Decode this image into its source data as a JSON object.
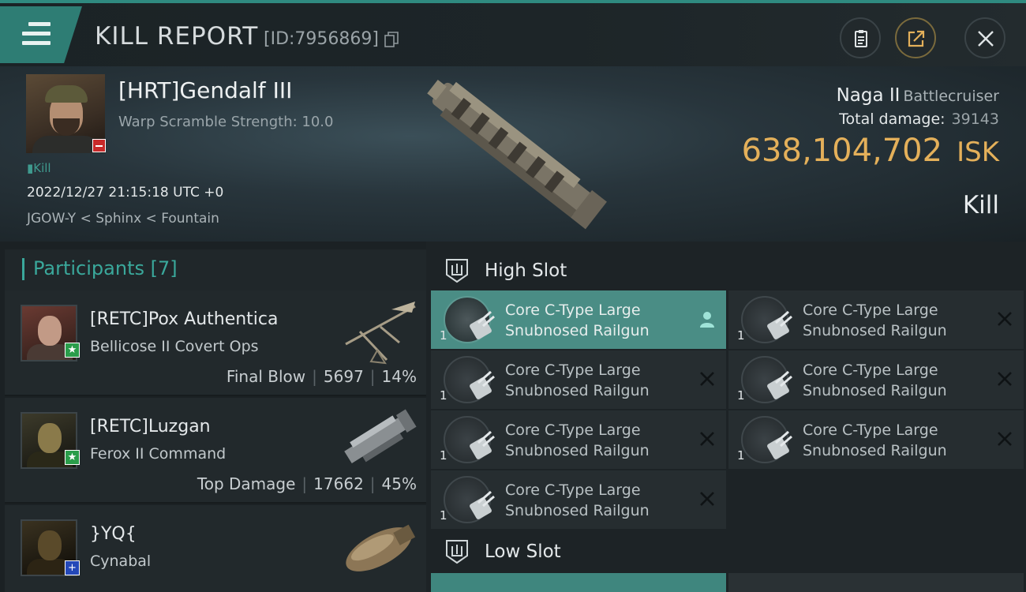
{
  "header": {
    "title": "KILL REPORT",
    "report_id": "[ID:7956869]",
    "icons": [
      "menu-icon",
      "copy-icon",
      "clipboard-icon",
      "share-icon",
      "close-icon"
    ]
  },
  "victim": {
    "name": "[HRT]Gendalf III",
    "warp_scramble": "Warp Scramble Strength: 10.0",
    "kill_tag": "Kill",
    "timestamp": "2022/12/27 21:15:18 UTC +0",
    "location": "JGOW-Y < Sphinx < Fountain",
    "ship_name": "Naga II",
    "ship_class": "Battlecruiser",
    "total_damage_label": "Total damage:",
    "total_damage": "39143",
    "isk_value": "638,104,702",
    "isk_unit": "ISK",
    "report_type": "Kill"
  },
  "participants": {
    "label": "Participants",
    "count": "[7]",
    "rows": [
      {
        "name": "[RETC]Pox Authentica",
        "ship": "Bellicose II Covert Ops",
        "tag": "Final Blow",
        "damage": "5697",
        "percent": "14%",
        "badge": "★",
        "badge_color": "#2a9d4a"
      },
      {
        "name": "[RETC]Luzgan",
        "ship": "Ferox II Command",
        "tag": "Top Damage",
        "damage": "17662",
        "percent": "45%",
        "badge": "★",
        "badge_color": "#2a9d4a"
      },
      {
        "name": "}YQ{",
        "ship": "Cynabal",
        "badge": "+",
        "badge_color": "#2448b8"
      }
    ]
  },
  "fitting": {
    "high_slot_label": "High Slot",
    "low_slot_label": "Low Slot",
    "modules": [
      {
        "line1": "Core C-Type Large",
        "line2": "Snubnosed Railgun",
        "qty": "1",
        "state": "pilot-icon"
      },
      {
        "line1": "Core C-Type Large",
        "line2": "Snubnosed Railgun",
        "qty": "1",
        "state": "destroyed-icon"
      },
      {
        "line1": "Core C-Type Large",
        "line2": "Snubnosed Railgun",
        "qty": "1",
        "state": "destroyed-icon"
      },
      {
        "line1": "Core C-Type Large",
        "line2": "Snubnosed Railgun",
        "qty": "1",
        "state": "destroyed-icon"
      },
      {
        "line1": "Core C-Type Large",
        "line2": "Snubnosed Railgun",
        "qty": "1",
        "state": "destroyed-icon"
      },
      {
        "line1": "Core C-Type Large",
        "line2": "Snubnosed Railgun",
        "qty": "1",
        "state": "destroyed-icon"
      },
      {
        "line1": "Core C-Type Large",
        "line2": "Snubnosed Railgun",
        "qty": "1",
        "state": "destroyed-icon"
      }
    ]
  },
  "colors": {
    "accent_teal": "#3aa89b",
    "isk_gold": "#e4b05a",
    "active_module": "#4a8d85"
  }
}
